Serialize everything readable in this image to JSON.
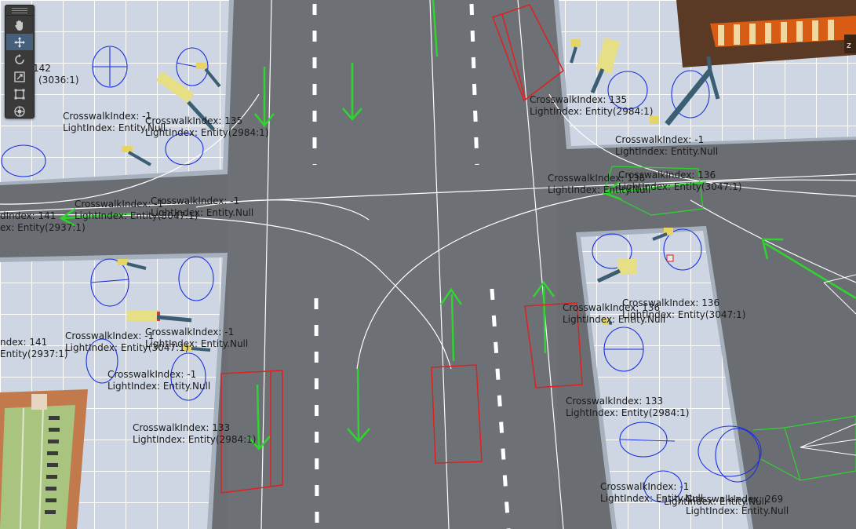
{
  "toolbar": {
    "tools": [
      {
        "name": "hand-tool",
        "icon": "hand-icon",
        "active": false
      },
      {
        "name": "move-tool",
        "icon": "move-icon",
        "active": true
      },
      {
        "name": "rotate-tool",
        "icon": "rotate-icon",
        "active": false
      },
      {
        "name": "scale-tool",
        "icon": "scale-icon",
        "active": false
      },
      {
        "name": "rect-tool",
        "icon": "rect-tool-icon",
        "active": false
      },
      {
        "name": "transform-tool",
        "icon": "transform-icon",
        "active": false
      }
    ]
  },
  "colors": {
    "road": "#6a6d71",
    "sidewalk": "#c9d3df",
    "grid": "#ffffff",
    "lane_marking": "#ffffff",
    "nav_arrow": "#2fd52f",
    "trigger_box": "#e02020",
    "gizmo_circle": "#1a2ee0",
    "label_text": "#1b1b1b"
  },
  "labels": {
    "l1": {
      "line1": "142",
      "line2": "(3036:1)"
    },
    "l2": {
      "line1": "CrosswalkIndex: -1",
      "line2": "LightIndex: Entity.Null"
    },
    "l3": {
      "line1": "CrosswalkIndex: 135",
      "line2": "LightIndex: Entity(2984:1)"
    },
    "l4": {
      "line1": "CrosswalkIndex: 135",
      "line2": "LightIndex: Entity(2984:1)"
    },
    "l5": {
      "line1": "CrosswalkIndex: -1",
      "line2": "LightIndex: Entity.Null"
    },
    "l6": {
      "line1": "CrosswalkIndex: 136",
      "line2": "LightIndex: Entity(3047:1)"
    },
    "l6b": {
      "line1": "",
      "line2": "LightIndex: Entity.Null"
    },
    "l7": {
      "line1": "CrosswalkIndex: -1",
      "line2": "LightIndex: Entity.Null"
    },
    "l8": {
      "line1": "CrosswalkIndex: 136",
      "line2": "LightIndex: Entity(3047:1)"
    },
    "l9": {
      "line1": "dIndex: 141",
      "line2": "ex: Entity(2937:1)"
    },
    "l10": {
      "line1": "CrosswalkIndex: -1",
      "line2": "LightIndex: Entity(3047:1)"
    },
    "l11": {
      "line1": "CrosswalkIndex: -1",
      "line2": "LightIndex: Entity.Null"
    },
    "l12": {
      "line1": "ndex: 141",
      "line2": "Entity(2937:1)"
    },
    "l13": {
      "line1": "CrosswalkIndex: -1",
      "line2": "LightIndex: Entity.Null"
    },
    "l14": {
      "line1": "CrosswalkIndex: 133",
      "line2": "LightIndex: Entity(2984:1)"
    },
    "l15": {
      "line1": "CrosswalkIndex: 136",
      "line2": "LightIndex: Entity.Null"
    },
    "l16": {
      "line1": "CrosswalkIndex: 136",
      "line2": "LightIndex: Entity(3047:1)"
    },
    "l17": {
      "line1": "CrosswalkIndex: 133",
      "line2": "LightIndex: Entity(2984:1)"
    },
    "l18": {
      "line1": "CrosswalkIndex: -1",
      "line2": "LightIndex: Entity.Null"
    },
    "l19": {
      "line1": "CrosswalkIndex: 269",
      "line2": "LightIndex: Entity.Null"
    },
    "l20": {
      "line1": "",
      "line2": "LightIndex: Entity.Null"
    }
  },
  "shop": {
    "sign_letter": "z"
  }
}
